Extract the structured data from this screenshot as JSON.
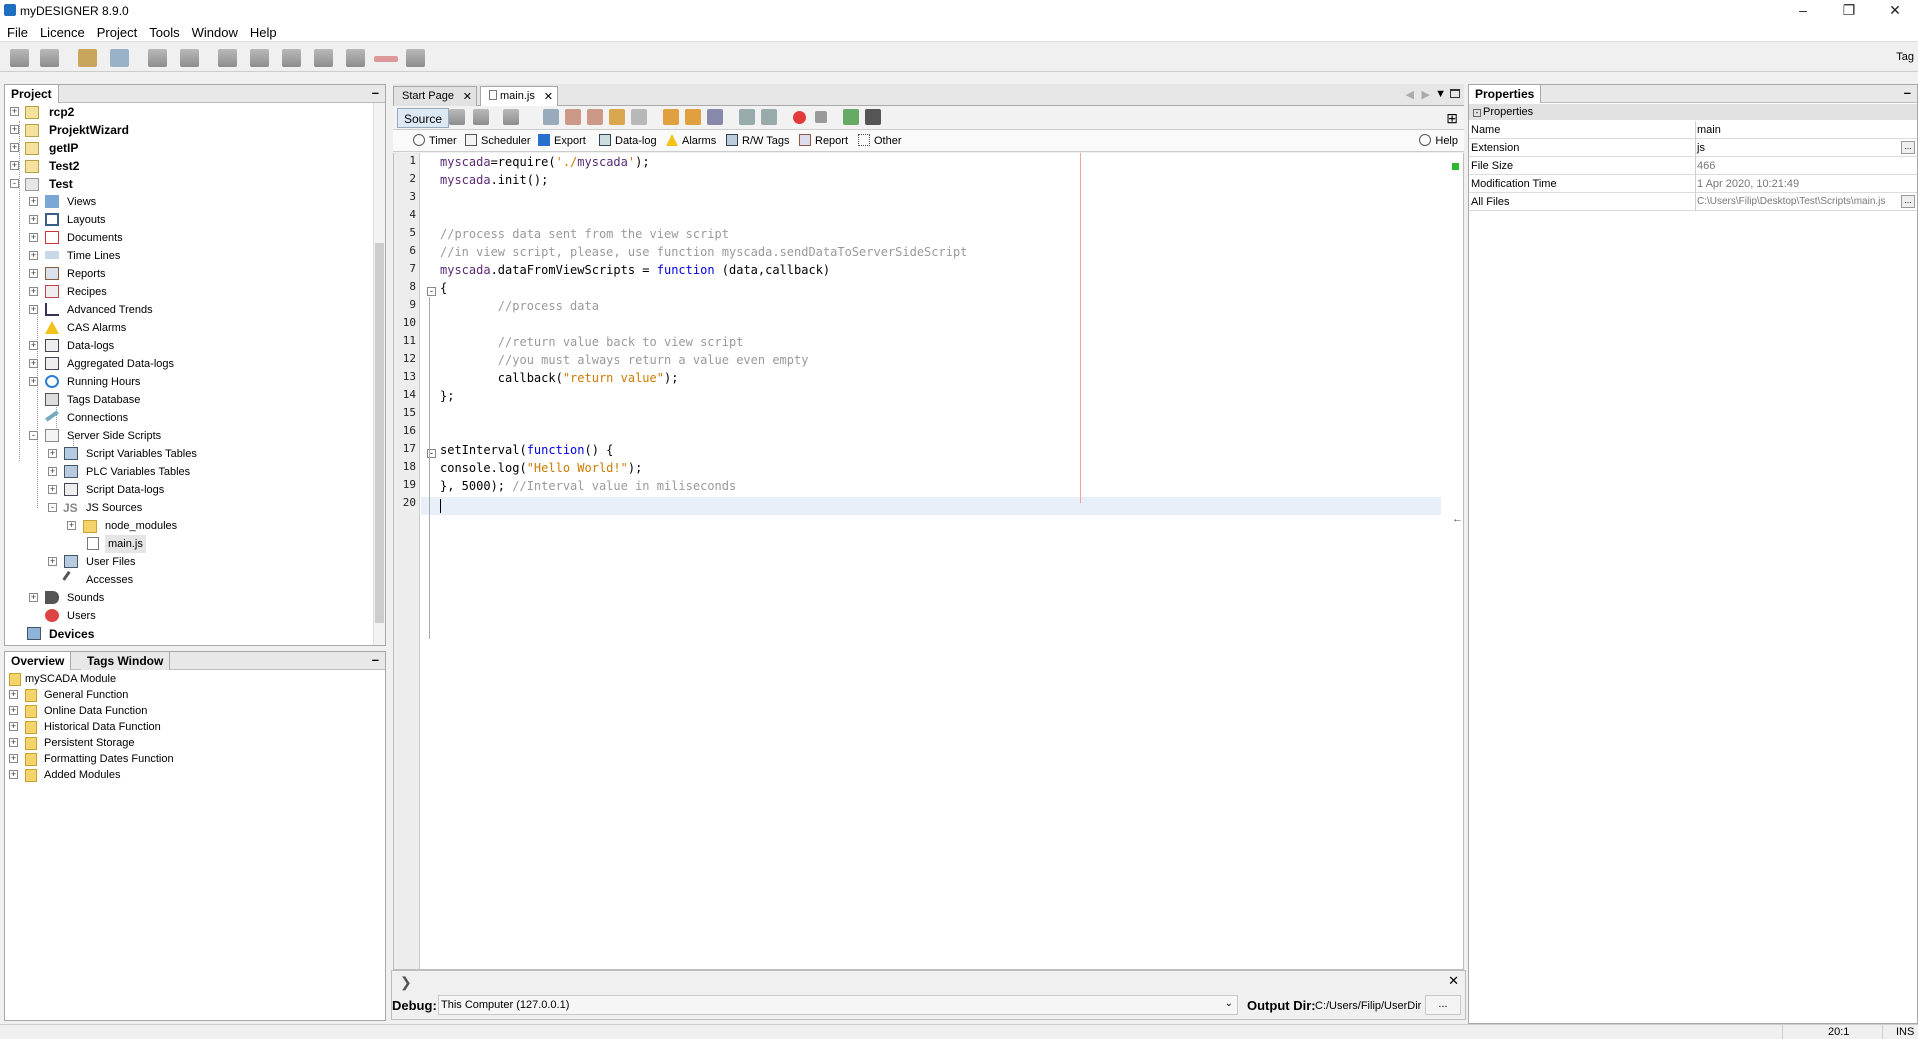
{
  "window": {
    "title": "myDESIGNER 8.9.0",
    "controls": [
      "–",
      "❐",
      "✕"
    ]
  },
  "menu": [
    "File",
    "Licence",
    "Project",
    "Tools",
    "Window",
    "Help"
  ],
  "toolbar": {
    "right_label": "Tag"
  },
  "project_panel": {
    "tab": "Project",
    "items": [
      {
        "label": "rcp2",
        "bold": true
      },
      {
        "label": "ProjektWizard",
        "bold": true
      },
      {
        "label": "getIP",
        "bold": true
      },
      {
        "label": "Test2",
        "bold": true
      },
      {
        "label": "Test",
        "bold": true
      },
      {
        "label": "Views"
      },
      {
        "label": "Layouts"
      },
      {
        "label": "Documents"
      },
      {
        "label": "Time Lines"
      },
      {
        "label": "Reports"
      },
      {
        "label": "Recipes"
      },
      {
        "label": "Advanced Trends"
      },
      {
        "label": "CAS Alarms"
      },
      {
        "label": "Data-logs"
      },
      {
        "label": "Aggregated Data-logs"
      },
      {
        "label": "Running Hours"
      },
      {
        "label": "Tags Database"
      },
      {
        "label": "Connections"
      },
      {
        "label": "Server Side Scripts"
      },
      {
        "label": "Script Variables Tables"
      },
      {
        "label": "PLC Variables Tables"
      },
      {
        "label": "Script Data-logs"
      },
      {
        "label": "JS Sources"
      },
      {
        "label": "node_modules"
      },
      {
        "label": "main.js"
      },
      {
        "label": "User Files"
      },
      {
        "label": "Accesses"
      },
      {
        "label": "Sounds"
      },
      {
        "label": "Users"
      },
      {
        "label": "Devices",
        "bold": true
      }
    ],
    "js_prefix": "JS"
  },
  "overview_panel": {
    "tabs": [
      "Overview",
      "Tags Window"
    ],
    "items": [
      "mySCADA Module",
      "General Function",
      "Online Data Function",
      "Historical Data Function",
      "Persistent Storage",
      "Formatting Dates Function",
      "Added Modules"
    ]
  },
  "editor": {
    "tabs": [
      "Start Page",
      "main.js"
    ],
    "source_label": "Source",
    "palette": [
      "Timer",
      "Scheduler",
      "Export",
      "Data-log",
      "Alarms",
      "R/W Tags",
      "Report",
      "Other"
    ],
    "help": "Help",
    "line_numbers": [
      "1",
      "2",
      "3",
      "4",
      "5",
      "6",
      "7",
      "8",
      "9",
      "10",
      "11",
      "12",
      "13",
      "14",
      "15",
      "16",
      "17",
      "18",
      "19",
      "20"
    ],
    "code": [
      "myscada=require('./myscada');",
      "myscada.init();",
      "",
      "",
      "//process data sent from the view script",
      "//in view script, please, use function myscada.sendDataToServerSideScript",
      "myscada.dataFromViewScripts = function (data,callback)",
      "{",
      "        //process data",
      "",
      "        //return value back to view script",
      "        //you must always return a value even empty",
      "        callback(\"return value\");",
      "};",
      "",
      "",
      "setInterval(function() {",
      "console.log(\"Hello World!\");",
      "}, 5000); //Interval value in miliseconds",
      ""
    ]
  },
  "properties": {
    "title": "Properties",
    "section": "Properties",
    "rows": [
      {
        "key": "Name",
        "value": "main"
      },
      {
        "key": "Extension",
        "value": "js"
      },
      {
        "key": "File Size",
        "value": "466"
      },
      {
        "key": "Modification Time",
        "value": "1 Apr 2020, 10:21:49"
      },
      {
        "key": "All Files",
        "value": "C:\\Users\\Filip\\Desktop\\Test\\Scripts\\main.js"
      }
    ]
  },
  "debug": {
    "label": "Debug:",
    "value": "This Computer (127.0.0.1)",
    "output_label": "Output Dir:",
    "output_value": "C:/Users/Filip/UserDir",
    "more": "..."
  },
  "status": {
    "position": "20:1",
    "mode": "INS"
  }
}
